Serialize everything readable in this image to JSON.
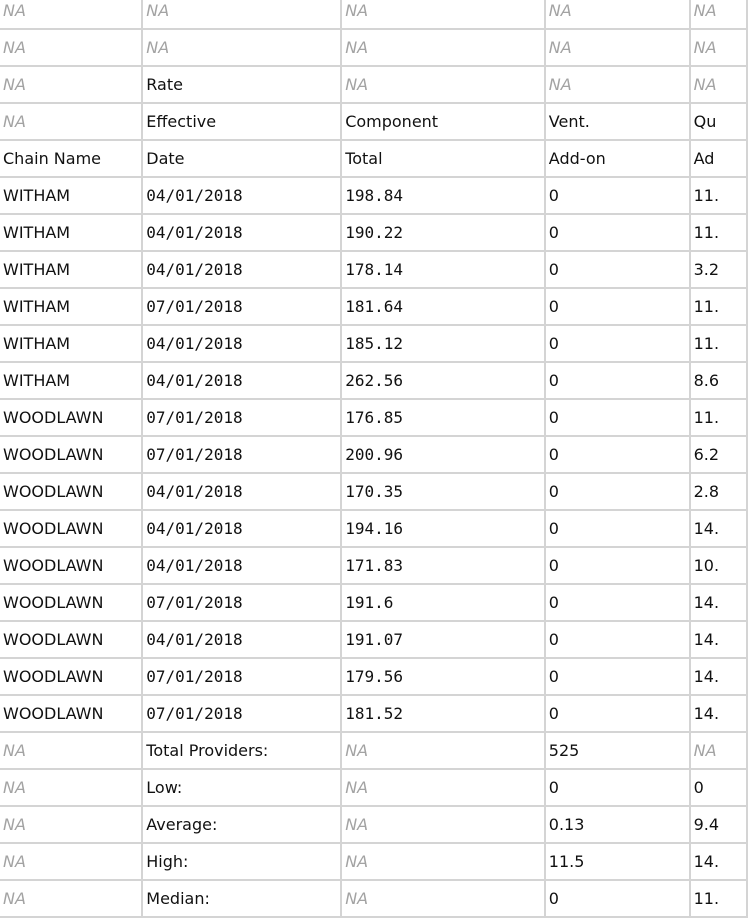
{
  "na": "NA",
  "header_rows": [
    [
      "NA",
      "NA",
      "NA",
      "NA",
      "NA"
    ],
    [
      "NA",
      "NA",
      "NA",
      "NA",
      "NA"
    ],
    [
      "NA",
      "Rate",
      "NA",
      "NA",
      "NA"
    ],
    [
      "NA",
      "Effective",
      "Component",
      "Vent.",
      "Qu"
    ],
    [
      "Chain Name",
      "Date",
      "Total",
      "Add-on",
      "Ad"
    ]
  ],
  "data_rows": [
    [
      "WITHAM",
      "04/01/2018",
      "198.84",
      "0",
      "11."
    ],
    [
      "WITHAM",
      "04/01/2018",
      "190.22",
      "0",
      "11."
    ],
    [
      "WITHAM",
      "04/01/2018",
      "178.14",
      "0",
      "3.2"
    ],
    [
      "WITHAM",
      "07/01/2018",
      "181.64",
      "0",
      "11."
    ],
    [
      "WITHAM",
      "04/01/2018",
      "185.12",
      "0",
      "11."
    ],
    [
      "WITHAM",
      "04/01/2018",
      "262.56",
      "0",
      "8.6"
    ],
    [
      "WOODLAWN",
      "07/01/2018",
      "176.85",
      "0",
      "11."
    ],
    [
      "WOODLAWN",
      "07/01/2018",
      "200.96",
      "0",
      "6.2"
    ],
    [
      "WOODLAWN",
      "04/01/2018",
      "170.35",
      "0",
      "2.8"
    ],
    [
      "WOODLAWN",
      "04/01/2018",
      "194.16",
      "0",
      "14."
    ],
    [
      "WOODLAWN",
      "04/01/2018",
      "171.83",
      "0",
      "10."
    ],
    [
      "WOODLAWN",
      "07/01/2018",
      "191.6",
      "0",
      "14."
    ],
    [
      "WOODLAWN",
      "04/01/2018",
      "191.07",
      "0",
      "14."
    ],
    [
      "WOODLAWN",
      "07/01/2018",
      "179.56",
      "0",
      "14."
    ],
    [
      "WOODLAWN",
      "07/01/2018",
      "181.52",
      "0",
      "14."
    ]
  ],
  "summary_rows": [
    [
      "NA",
      "Total Providers:",
      "NA",
      "525",
      "NA"
    ],
    [
      "NA",
      "Low:",
      "NA",
      "0",
      "0"
    ],
    [
      "NA",
      "Average:",
      "NA",
      "0.13",
      "9.4"
    ],
    [
      "NA",
      "High:",
      "NA",
      "11.5",
      "14."
    ],
    [
      "NA",
      "Median:",
      "NA",
      "0",
      "11."
    ]
  ]
}
